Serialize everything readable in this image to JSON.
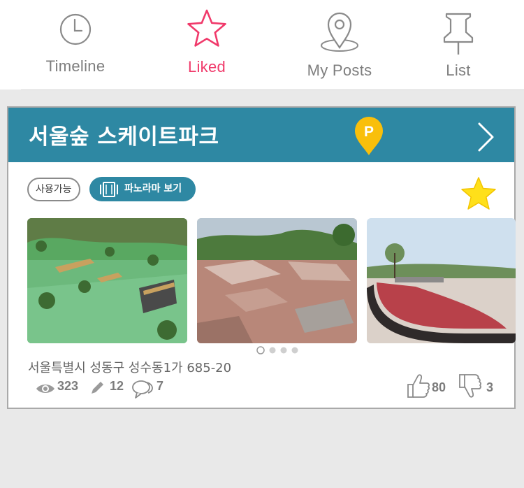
{
  "tabs": [
    {
      "label": "Timeline",
      "icon": "clock-icon",
      "active": false
    },
    {
      "label": "Liked",
      "icon": "star-outline-icon",
      "active": true
    },
    {
      "label": "My Posts",
      "icon": "location-pin-icon",
      "active": false
    },
    {
      "label": "List",
      "icon": "pushpin-icon",
      "active": false
    }
  ],
  "card": {
    "title": "서울숲 스케이트파크",
    "parking_label": "P",
    "status_badge": "사용가능",
    "panorama_button": "파노라마 보기",
    "address": "서울특별시 성동구 성수동1가 685-20",
    "photos_count": 3,
    "carousel_dots": 4,
    "stats": {
      "views": "323",
      "edits": "12",
      "comments": "7",
      "likes": "80",
      "dislikes": "3"
    }
  },
  "colors": {
    "accent_teal": "#2e88a3",
    "active_tab": "#f0396a",
    "star_yellow": "#ffe01a",
    "parking_marker": "#f9bf0b"
  }
}
